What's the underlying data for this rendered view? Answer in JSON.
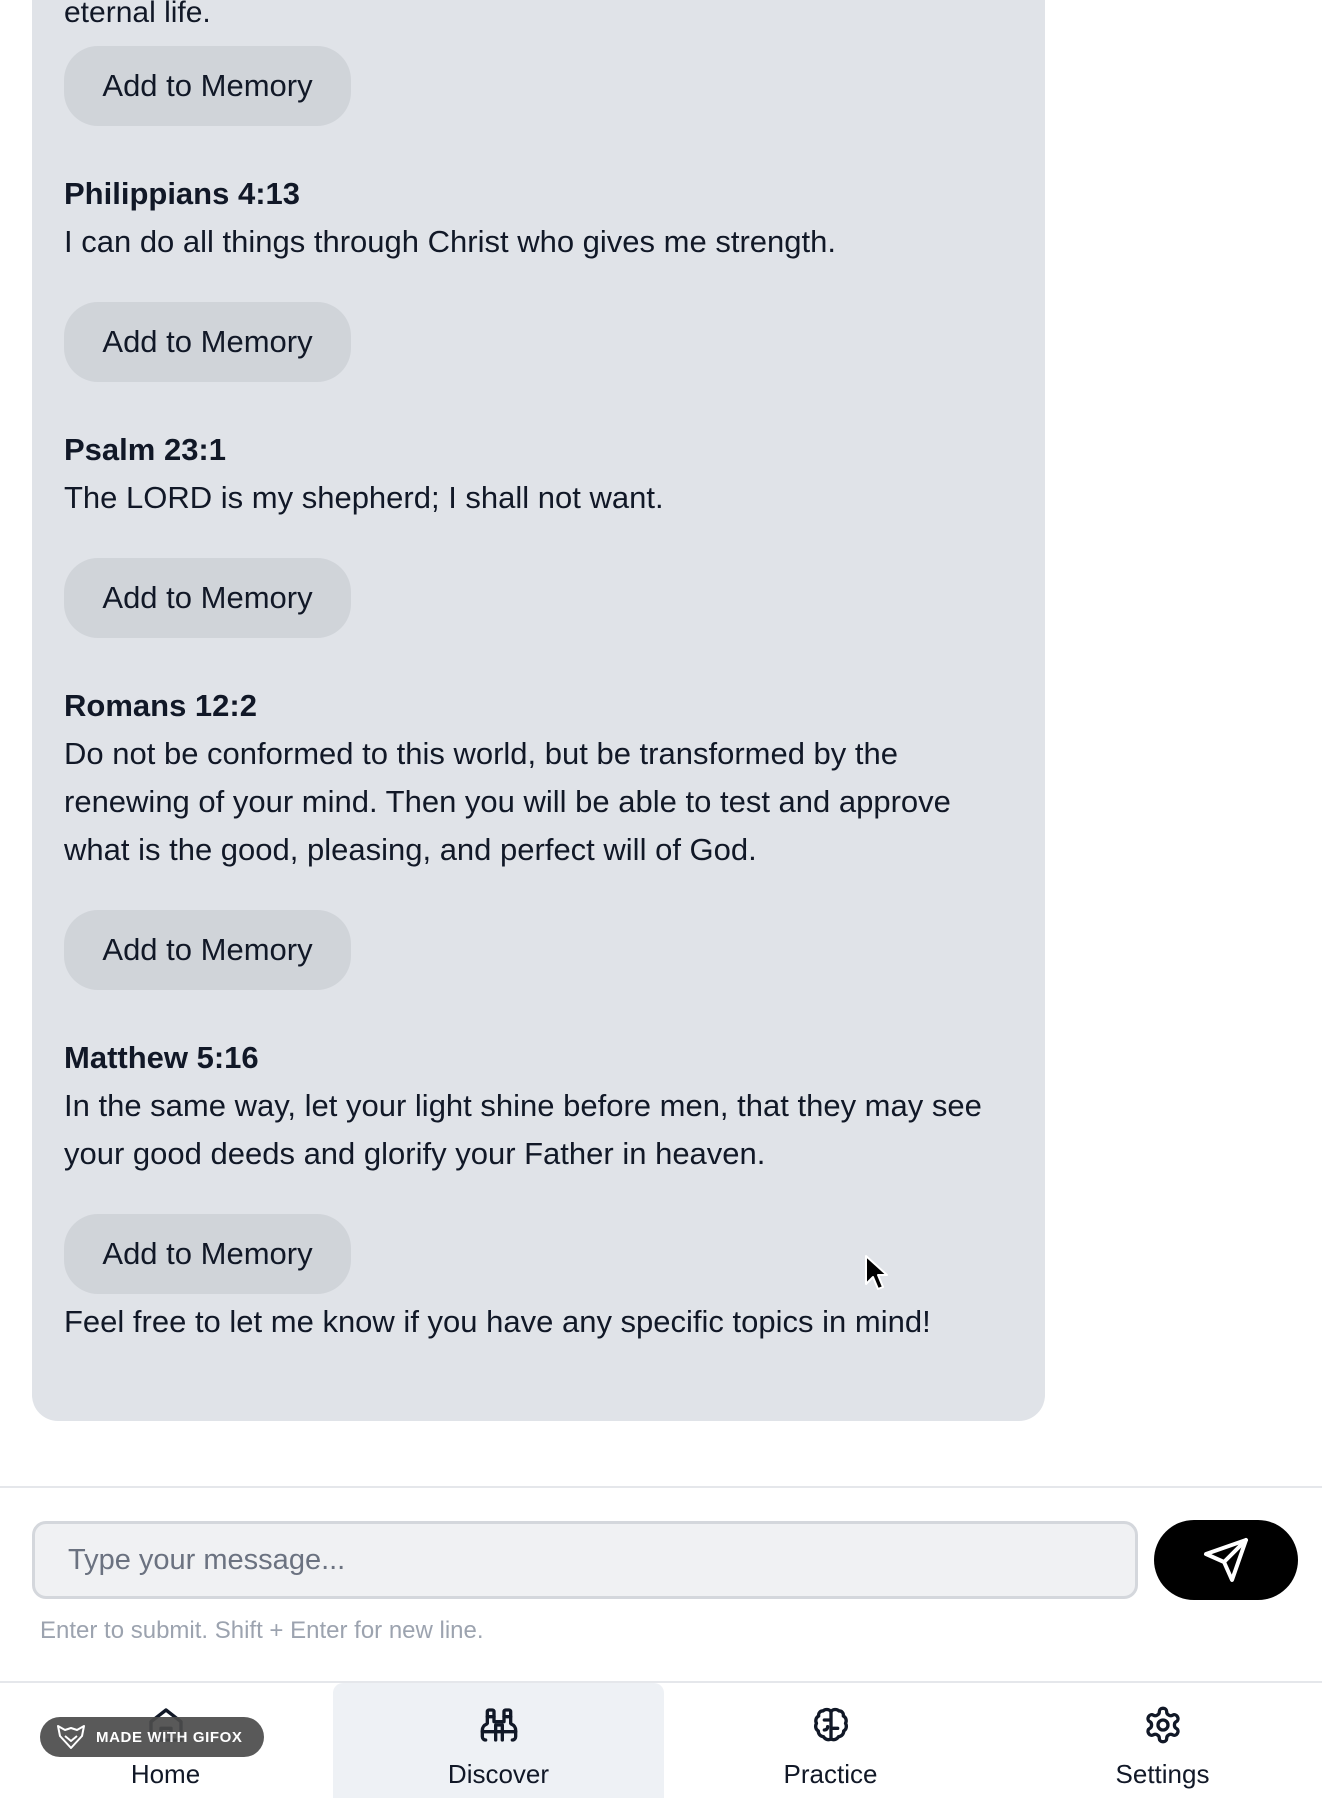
{
  "chat": {
    "cut_text": "eternal life.",
    "add_label": "Add to Memory",
    "verses": [
      {
        "reference": "Philippians 4:13",
        "text": "I can do all things through Christ who gives me strength."
      },
      {
        "reference": "Psalm 23:1",
        "text": "The LORD is my shepherd; I shall not want."
      },
      {
        "reference": "Romans 12:2",
        "text": "Do not be conformed to this world, but be transformed by the renewing of your mind. Then you will be able to test and approve what is the good, pleasing, and perfect will of God."
      },
      {
        "reference": "Matthew 5:16",
        "text": "In the same way, let your light shine before men, that they may see your good deeds and glorify your Father in heaven."
      }
    ],
    "closing": "Feel free to let me know if you have any specific topics in mind!"
  },
  "composer": {
    "placeholder": "Type your message...",
    "hint": "Enter to submit. Shift + Enter for new line.",
    "send_icon": "send-icon"
  },
  "nav": {
    "items": [
      {
        "label": "Home",
        "icon": "home-icon",
        "active": false
      },
      {
        "label": "Discover",
        "icon": "binoculars-icon",
        "active": true
      },
      {
        "label": "Practice",
        "icon": "brain-icon",
        "active": false
      },
      {
        "label": "Settings",
        "icon": "gear-icon",
        "active": false
      }
    ]
  },
  "watermark": {
    "text": "MADE WITH GIFOX"
  },
  "colors": {
    "bubble": "#e0e3e8",
    "button": "#d0d4d9",
    "send_button": "#000000",
    "active_nav": "#eef1f5"
  }
}
